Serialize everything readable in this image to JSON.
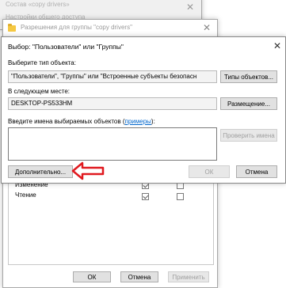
{
  "bg_window": {
    "top_text": "Состав «copy drivers»",
    "second_text": "Настройки общего доступа"
  },
  "perm_window": {
    "title": "Разрешения для группы \"copy drivers\"",
    "close": "✕",
    "rows": [
      {
        "label": "Изменение",
        "allow": true,
        "deny": false
      },
      {
        "label": "Чтение",
        "allow": true,
        "deny": false
      }
    ],
    "ok": "ОК",
    "cancel": "Отмена",
    "apply": "Применить"
  },
  "select_dialog": {
    "title": "Выбор: \"Пользователи\" или \"Группы\"",
    "close": "✕",
    "type_label": "Выберите тип объекта:",
    "type_value": "\"Пользователи\", \"Группы\" или \"Встроенные субъекты безопасн",
    "type_button": "Типы объектов...",
    "location_label": "В следующем месте:",
    "location_value": "DESKTOP-PS533HM",
    "location_button": "Размещение...",
    "names_label": "Введите имена выбираемых объектов (",
    "names_link": "примеры",
    "names_label_end": "):",
    "check_names": "Проверить имена",
    "advanced": "Дополнительно...",
    "ok": "ОК",
    "cancel": "Отмена"
  },
  "colors": {
    "arrow": "#e0191f",
    "link": "#0066cc"
  }
}
